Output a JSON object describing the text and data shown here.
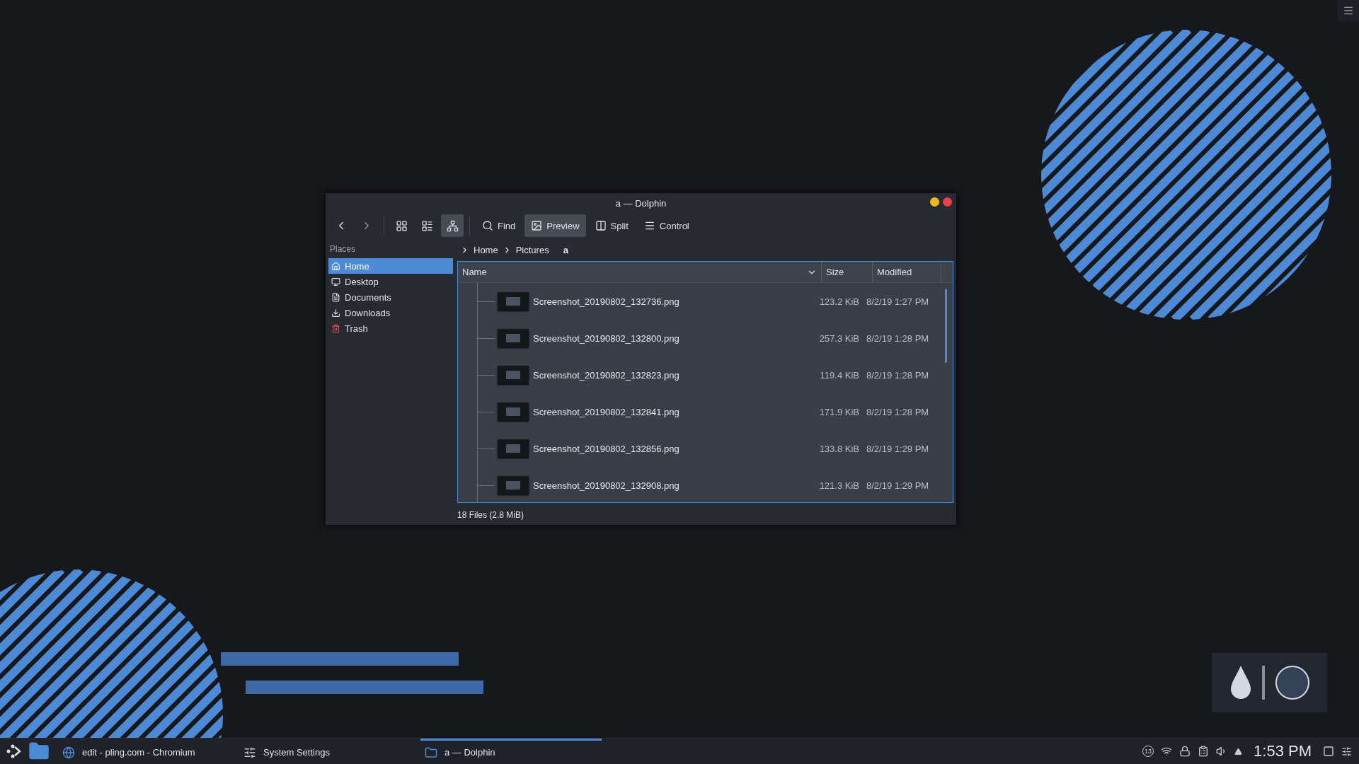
{
  "window": {
    "title": "a — Dolphin"
  },
  "view_modes": [
    {
      "kind": "icons",
      "selected": false
    },
    {
      "kind": "compact",
      "selected": false
    },
    {
      "kind": "details",
      "selected": true
    }
  ],
  "actions": [
    {
      "kind": "find",
      "label": "Find",
      "selected": false
    },
    {
      "kind": "preview",
      "label": "Preview",
      "selected": true
    },
    {
      "kind": "split",
      "label": "Split",
      "selected": false
    },
    {
      "kind": "control",
      "label": "Control",
      "selected": false
    }
  ],
  "places": {
    "title": "Places",
    "items": [
      {
        "kind": "home",
        "label": "Home",
        "selected": true
      },
      {
        "kind": "desktop",
        "label": "Desktop",
        "selected": false
      },
      {
        "kind": "documents",
        "label": "Documents",
        "selected": false
      },
      {
        "kind": "downloads",
        "label": "Downloads",
        "selected": false
      },
      {
        "kind": "trash",
        "label": "Trash",
        "selected": false
      }
    ]
  },
  "breadcrumb": [
    "Home",
    "Pictures",
    "a"
  ],
  "columns": [
    "Name",
    "Size",
    "Modified"
  ],
  "rows": [
    {
      "name": "Screenshot_20190802_132736.png",
      "size": "123.2 KiB",
      "modified": "8/2/19 1:27 PM"
    },
    {
      "name": "Screenshot_20190802_132800.png",
      "size": "257.3 KiB",
      "modified": "8/2/19 1:28 PM"
    },
    {
      "name": "Screenshot_20190802_132823.png",
      "size": "119.4 KiB",
      "modified": "8/2/19 1:28 PM"
    },
    {
      "name": "Screenshot_20190802_132841.png",
      "size": "171.9 KiB",
      "modified": "8/2/19 1:28 PM"
    },
    {
      "name": "Screenshot_20190802_132856.png",
      "size": "133.8 KiB",
      "modified": "8/2/19 1:29 PM"
    },
    {
      "name": "Screenshot_20190802_132908.png",
      "size": "121.3 KiB",
      "modified": "8/2/19 1:29 PM"
    }
  ],
  "status_bar": "18 Files (2.8 MiB)",
  "taskbar": {
    "tasks": [
      {
        "kind": "browser",
        "label": "edit - pling.com - Chromium",
        "selected": false
      },
      {
        "kind": "settings",
        "label": "System Settings",
        "selected": false
      },
      {
        "kind": "folder",
        "label": "a — Dolphin",
        "selected": true
      }
    ],
    "tray": {
      "badge": "13",
      "clock": "1:53 PM"
    }
  }
}
